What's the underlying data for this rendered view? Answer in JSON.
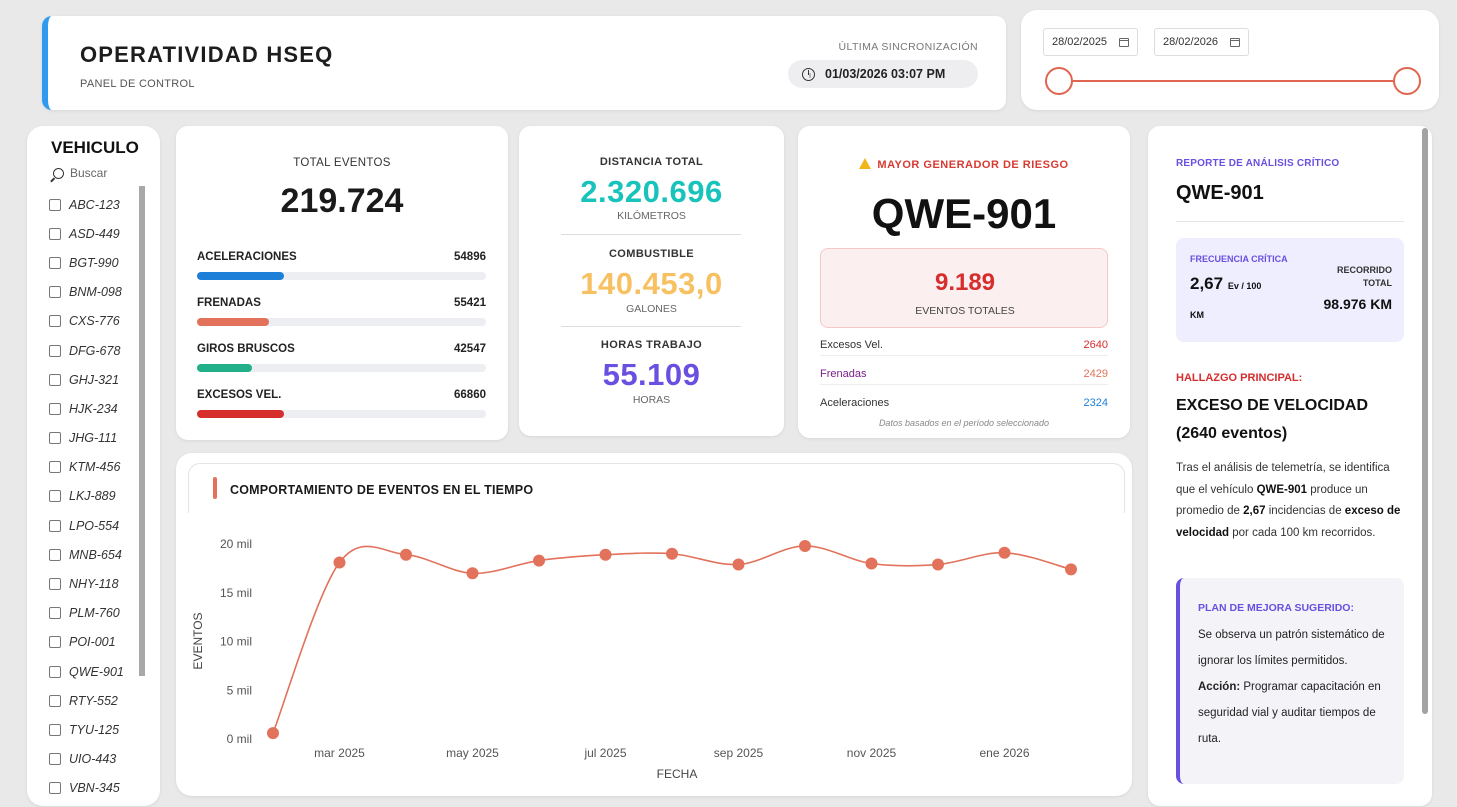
{
  "header": {
    "title": "OPERATIVIDAD HSEQ",
    "subtitle": "PANEL DE CONTROL",
    "sync_label": "ÚLTIMA SINCRONIZACIÓN",
    "sync_value": "01/03/2026 03:07 PM"
  },
  "date_range": {
    "start": "28/02/2025",
    "end": "28/02/2026",
    "accent": "#e06650"
  },
  "vehicles": {
    "title": "VEHICULO",
    "search_placeholder": "Buscar",
    "items": [
      "ABC-123",
      "ASD-449",
      "BGT-990",
      "BNM-098",
      "CXS-776",
      "DFG-678",
      "GHJ-321",
      "HJK-234",
      "JHG-111",
      "KTM-456",
      "LKJ-889",
      "LPO-554",
      "MNB-654",
      "NHY-118",
      "PLM-760",
      "POI-001",
      "QWE-901",
      "RTY-552",
      "TYU-125",
      "UIO-443",
      "VBN-345"
    ]
  },
  "events": {
    "title": "TOTAL EVENTOS",
    "total": "219.724",
    "breakdown": [
      {
        "label": "ACELERACIONES",
        "value": "54896",
        "fraction": 0.3,
        "color": "#1e7fd8"
      },
      {
        "label": "FRENADAS",
        "value": "55421",
        "fraction": 0.25,
        "color": "#e2725b"
      },
      {
        "label": "GIROS BRUSCOS",
        "value": "42547",
        "fraction": 0.19,
        "color": "#22b08a"
      },
      {
        "label": "EXCESOS VEL.",
        "value": "66860",
        "fraction": 0.3,
        "color": "#d62d2d"
      }
    ]
  },
  "distance": {
    "dist_label": "DISTANCIA TOTAL",
    "dist_value": "2.320.696",
    "dist_unit": "KILÓMETROS",
    "fuel_label": "COMBUSTIBLE",
    "fuel_value": "140.453,0",
    "fuel_unit": "GALONES",
    "hours_label": "HORAS TRABAJO",
    "hours_value": "55.109",
    "hours_unit": "HORAS",
    "colors": {
      "dist": "#18c3bb",
      "fuel": "#f7c162",
      "hours": "#6a4fe0"
    }
  },
  "risk": {
    "title": "MAYOR GENERADOR DE RIESGO",
    "plate": "QWE-901",
    "total": "9.189",
    "total_label": "EVENTOS TOTALES",
    "rows": [
      {
        "label": "Excesos Vel.",
        "value": "2640",
        "label_color": "#333",
        "value_color": "#d62d2d"
      },
      {
        "label": "Frenadas",
        "value": "2429",
        "label_color": "#7a1f8a",
        "value_color": "#e2725b"
      },
      {
        "label": "Aceleraciones",
        "value": "2324",
        "label_color": "#333",
        "value_color": "#1e7fd8"
      }
    ],
    "note": "Datos basados en el período seleccionado"
  },
  "chart_data": {
    "type": "line",
    "title": "COMPORTAMIENTO DE EVENTOS EN EL TIEMPO",
    "xlabel": "FECHA",
    "ylabel": "EVENTOS",
    "x": [
      "feb 2025",
      "mar 2025",
      "abr 2025",
      "may 2025",
      "jun 2025",
      "jul 2025",
      "ago 2025",
      "sep 2025",
      "oct 2025",
      "nov 2025",
      "dic 2025",
      "ene 2026",
      "feb 2026"
    ],
    "x_tick_labels": [
      "mar 2025",
      "may 2025",
      "jul 2025",
      "sep 2025",
      "nov 2025",
      "ene 2026"
    ],
    "y_tick_labels": [
      "0 mil",
      "5 mil",
      "10 mil",
      "15 mil",
      "20 mil"
    ],
    "ylim": [
      0,
      20000
    ],
    "series": [
      {
        "values": [
          600,
          18100,
          18900,
          17000,
          18300,
          18900,
          19000,
          17900,
          19800,
          18000,
          17900,
          19100,
          17400
        ],
        "color": "#e2725b"
      }
    ],
    "grid": false
  },
  "report": {
    "label": "REPORTE DE ANÁLISIS CRÍTICO",
    "plate": "QWE-901",
    "freq_label": "FRECUENCIA CRÍTICA",
    "freq_value": "2,67",
    "freq_unit": "Ev / 100",
    "freq_unit2": "KM",
    "recorrido_label": "RECORRIDO TOTAL",
    "recorrido_value": "98.976 KM",
    "finding_label": "HALLAZGO PRINCIPAL:",
    "finding_title": "EXCESO DE VELOCIDAD (2640 eventos)",
    "body_1": "Tras el análisis de telemetría, se identifica que el vehículo ",
    "body_plate": "QWE-901",
    "body_2": " produce un promedio de ",
    "body_rate": "2,67",
    "body_3": " incidencias de ",
    "body_type": "exceso de velocidad",
    "body_4": " por cada 100 km recorridos.",
    "plan_title": "PLAN DE MEJORA SUGERIDO:",
    "plan_1": "Se observa un patrón sistemático de ignorar los límites permitidos. ",
    "plan_action": "Acción:",
    "plan_2": " Programar capacitación en seguridad vial y auditar tiempos de ruta."
  }
}
